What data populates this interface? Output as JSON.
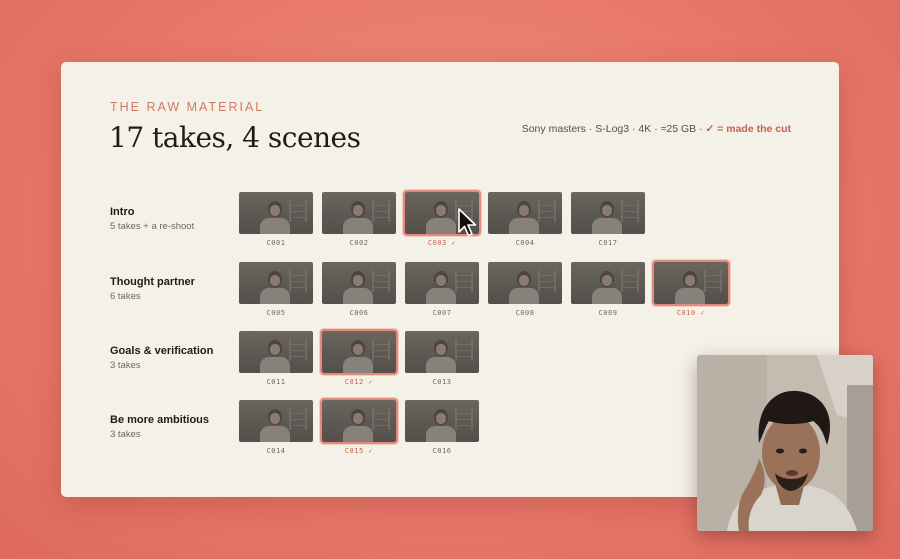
{
  "eyebrow": "THE RAW MATERIAL",
  "title": "17 takes, 4 scenes",
  "meta": {
    "info": "Sony masters · S-Log3 · 4K · ≈25 GB ·",
    "legend": "✓ = made the cut"
  },
  "scenes": [
    {
      "name": "Intro",
      "sub": "5 takes + a re-shoot",
      "clips": [
        {
          "code": "C001",
          "cut": false
        },
        {
          "code": "C002",
          "cut": false
        },
        {
          "code": "C003 ✓",
          "cut": true
        },
        {
          "code": "C004",
          "cut": false
        },
        {
          "code": "C017",
          "cut": false
        }
      ]
    },
    {
      "name": "Thought partner",
      "sub": "6 takes",
      "clips": [
        {
          "code": "C005",
          "cut": false
        },
        {
          "code": "C006",
          "cut": false
        },
        {
          "code": "C007",
          "cut": false
        },
        {
          "code": "C008",
          "cut": false
        },
        {
          "code": "C009",
          "cut": false
        },
        {
          "code": "C010 ✓",
          "cut": true
        }
      ]
    },
    {
      "name": "Goals & verification",
      "sub": "3 takes",
      "clips": [
        {
          "code": "C011",
          "cut": false
        },
        {
          "code": "C012 ✓",
          "cut": true
        },
        {
          "code": "C013",
          "cut": false
        }
      ]
    },
    {
      "name": "Be more ambitious",
      "sub": "3 takes",
      "clips": [
        {
          "code": "C014",
          "cut": false
        },
        {
          "code": "C015 ✓",
          "cut": true
        },
        {
          "code": "C016",
          "cut": false
        }
      ]
    }
  ],
  "colors": {
    "accent": "#d07a66",
    "cut_highlight": "#e58a7a",
    "slide_bg": "#f4f1e8",
    "page_bg": "#e8786a"
  },
  "icons": {
    "cursor": "mouse-pointer-icon"
  }
}
